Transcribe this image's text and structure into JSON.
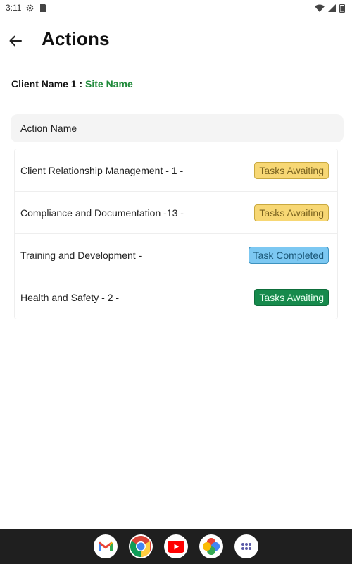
{
  "status_bar": {
    "time": "3:11"
  },
  "header": {
    "title": "Actions"
  },
  "client": {
    "client_name": "Client Name 1",
    "separator": " : ",
    "site_name": "Site Name"
  },
  "table": {
    "column_header": "Action Name",
    "rows": [
      {
        "label": "Client Relationship Management - 1 -",
        "status": "Tasks Awaiting"
      },
      {
        "label": "Compliance and Documentation -13 -",
        "status": "Tasks Awaiting"
      },
      {
        "label": "Training and Development -",
        "status": "Task Completed"
      },
      {
        "label": "Health and Safety - 2 -",
        "status": "Tasks Awaiting"
      }
    ]
  },
  "colors": {
    "site_name_green": "#1f8a3a",
    "awaiting_yellow": "#f7d774",
    "completed_blue": "#7cc8f2",
    "awaiting_green": "#168a4c"
  },
  "dock": {
    "apps": [
      "gmail-icon",
      "chrome-icon",
      "youtube-icon",
      "photos-icon",
      "app-drawer-icon"
    ]
  }
}
